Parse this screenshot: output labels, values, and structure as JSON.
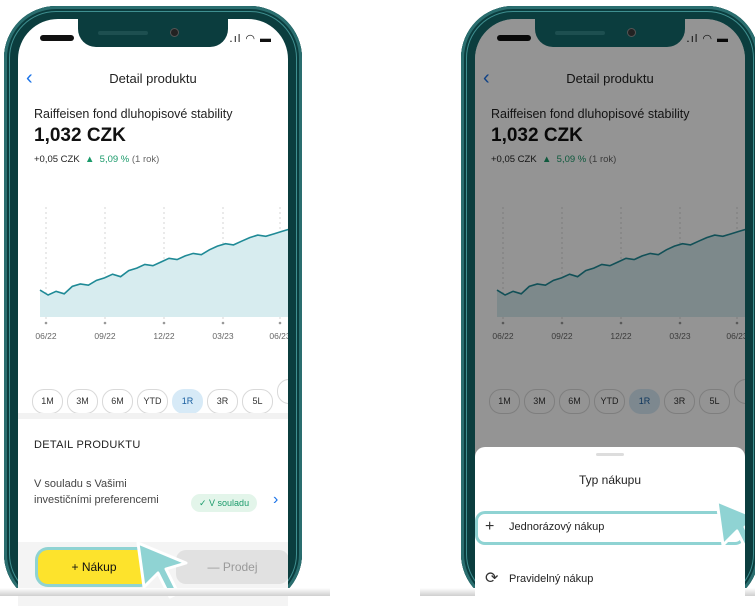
{
  "left_phone": {
    "status_icons": "․ıl ◠ ▬",
    "back_icon": "back-chevron-icon",
    "nav_title": "Detail produktu",
    "fund_name": "Raiffeisen fond dluhopisové stability",
    "price": "1,032 CZK",
    "change_abs": "+0,05 CZK",
    "change_pct": "5,09 %",
    "change_period": "(1 rok)",
    "ranges": [
      "1M",
      "3M",
      "6M",
      "YTD",
      "1R",
      "3R",
      "5L",
      ""
    ],
    "selected_range": "1R",
    "section_title": "DETAIL PRODUKTU",
    "pref_text": "V souladu s Vašimi investičními preferencemi",
    "pref_badge": "✓ V souladu",
    "buy_label": "+ Nákup",
    "sell_label": "— Prodej",
    "accent": "#fde32c",
    "highlight": "#8fd3d3"
  },
  "right_phone": {
    "nav_title": "Detail produktu",
    "fund_name": "Raiffeisen fond dluhopisové stability",
    "price": "1,032 CZK",
    "change_abs": "+0,05 CZK",
    "change_pct": "5,09 %",
    "change_period": "(1 rok)",
    "ranges": [
      "1M",
      "3M",
      "6M",
      "YTD",
      "1R",
      "3R",
      "5L",
      ""
    ],
    "sheet_title": "Typ nákupu",
    "option_one": "Jednorázový nákup",
    "option_two": "Pravidelný nákup"
  },
  "chart_data": {
    "type": "area",
    "x_ticks": [
      "06/22",
      "09/22",
      "12/22",
      "03/23",
      "06/23"
    ],
    "values": [
      0.982,
      0.978,
      0.981,
      0.979,
      0.985,
      0.987,
      0.986,
      0.99,
      0.992,
      0.995,
      0.993,
      0.998,
      1.0,
      1.003,
      1.002,
      1.005,
      1.008,
      1.007,
      1.01,
      1.012,
      1.011,
      1.015,
      1.018,
      1.02,
      1.019,
      1.022,
      1.025,
      1.027,
      1.026,
      1.028,
      1.03,
      1.032
    ],
    "ylim": [
      0.96,
      1.05
    ],
    "line_color": "#1f8a96",
    "fill_color": "#d7ecef",
    "grid": "vertical dashed"
  }
}
